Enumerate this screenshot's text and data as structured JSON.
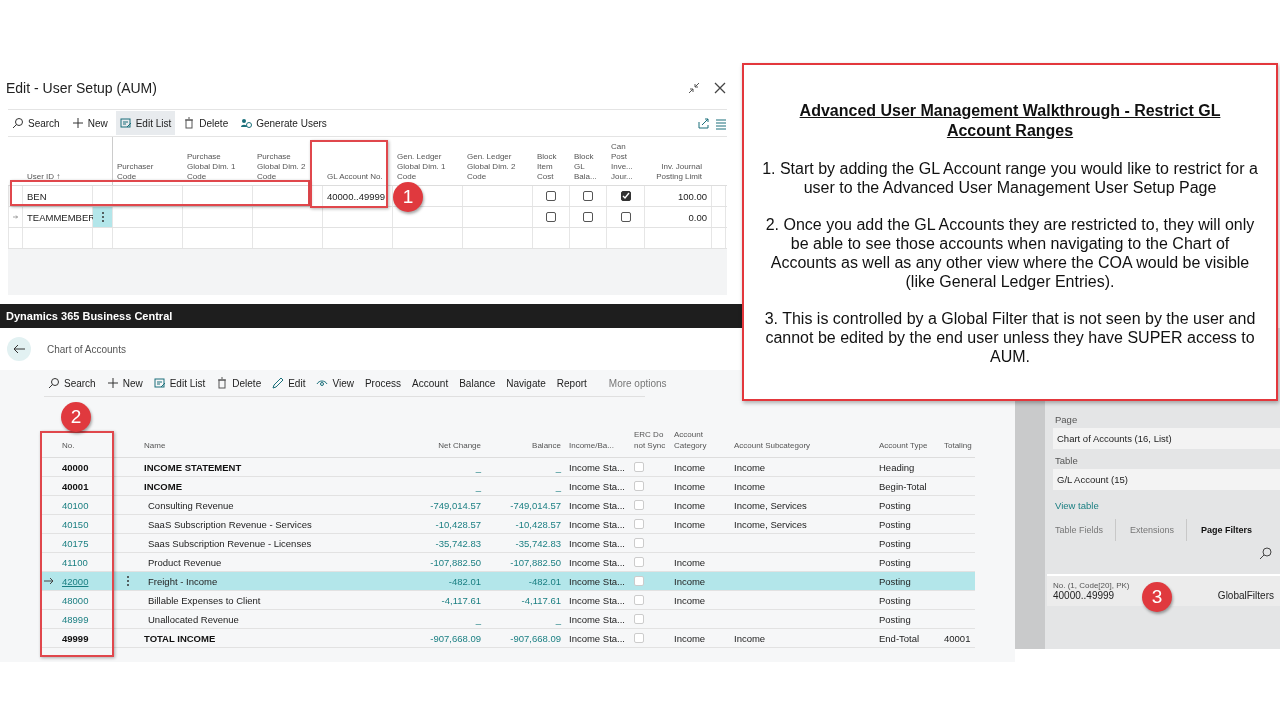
{
  "setup_window": {
    "title": "Edit - User Setup (AUM)",
    "toolbar": [
      {
        "label": "Search",
        "selected": false
      },
      {
        "label": "New",
        "selected": false
      },
      {
        "label": "Edit List",
        "selected": true
      },
      {
        "label": "Delete",
        "selected": false
      },
      {
        "label": "Generate Users",
        "selected": false
      }
    ],
    "columns": [
      "User ID ↑",
      "Purchaser Code",
      "Purchase Global Dim. 1 Code",
      "Purchase Global Dim. 2 Code",
      "GL Account No.",
      "Gen. Ledger Global Dim. 1 Code",
      "Gen. Ledger Global Dim. 2 Code",
      "Block Item Cost",
      "Block GL Bala...",
      "Can Post Inve... Jour...",
      "Inv. Journal Posting Limit"
    ],
    "rows": [
      {
        "user_id": "BEN",
        "gl_account_no": "40000..49999",
        "block_item_cost": false,
        "block_gl_balance": false,
        "can_post": true,
        "posting_limit": "100.00",
        "selected": false
      },
      {
        "user_id": "TEAMMEMBER",
        "block_item_cost": false,
        "block_gl_balance": false,
        "can_post": false,
        "posting_limit": "0.00",
        "selected": true
      }
    ]
  },
  "app_bar": {
    "title": "Dynamics 365 Business Central"
  },
  "chart_of_accounts": {
    "title": "Chart of Accounts",
    "toolbar": [
      "Search",
      "New",
      "Edit List",
      "Delete",
      "Edit",
      "View",
      "Process",
      "Account",
      "Balance",
      "Navigate",
      "Report"
    ],
    "more_options": "More options",
    "columns": [
      "No.",
      "Name",
      "Net Change",
      "Balance",
      "Income/Ba...",
      "ERC Do not Sync",
      "Account Category",
      "Account Subcategory",
      "Account Type",
      "Totaling"
    ],
    "rows": [
      {
        "kind": "heading",
        "no": "40000",
        "name": "INCOME STATEMENT",
        "net_change": "_",
        "balance": "_",
        "income_balance": "Income Sta...",
        "erc_do_not_sync": false,
        "category": "Income",
        "subcategory": "Income",
        "type": "Heading",
        "selected": false
      },
      {
        "kind": "heading",
        "no": "40001",
        "name": "INCOME",
        "net_change": "_",
        "balance": "_",
        "income_balance": "Income Sta...",
        "erc_do_not_sync": false,
        "category": "Income",
        "subcategory": "Income",
        "type": "Begin-Total",
        "selected": false
      },
      {
        "kind": "posting",
        "no": "40100",
        "name": "Consulting Revenue",
        "net_change": "-749,014.57",
        "balance": "-749,014.57",
        "income_balance": "Income Sta...",
        "erc_do_not_sync": false,
        "category": "Income",
        "subcategory": "Income, Services",
        "type": "Posting",
        "selected": false
      },
      {
        "kind": "posting",
        "no": "40150",
        "name": "SaaS Subscription Revenue - Services",
        "net_change": "-10,428.57",
        "balance": "-10,428.57",
        "income_balance": "Income Sta...",
        "erc_do_not_sync": false,
        "category": "Income",
        "subcategory": "Income, Services",
        "type": "Posting",
        "selected": false
      },
      {
        "kind": "posting",
        "no": "40175",
        "name": "Saas Subscription Revenue - Licenses",
        "net_change": "-35,742.83",
        "balance": "-35,742.83",
        "income_balance": "Income Sta...",
        "erc_do_not_sync": false,
        "type": "Posting",
        "selected": false
      },
      {
        "kind": "posting",
        "no": "41100",
        "name": "Product Revenue",
        "net_change": "-107,882.50",
        "balance": "-107,882.50",
        "income_balance": "Income Sta...",
        "erc_do_not_sync": false,
        "category": "Income",
        "type": "Posting",
        "selected": false
      },
      {
        "kind": "posting",
        "no": "42000",
        "name": "Freight - Income",
        "net_change": "-482.01",
        "balance": "-482.01",
        "income_balance": "Income Sta...",
        "erc_do_not_sync": false,
        "category": "Income",
        "type": "Posting",
        "selected": true
      },
      {
        "kind": "posting",
        "no": "48000",
        "name": "Billable Expenses to Client",
        "net_change": "-4,117.61",
        "balance": "-4,117.61",
        "income_balance": "Income Sta...",
        "erc_do_not_sync": false,
        "category": "Income",
        "type": "Posting",
        "selected": false
      },
      {
        "kind": "posting",
        "no": "48999",
        "name": "Unallocated Revenue",
        "net_change": "_",
        "balance": "_",
        "income_balance": "Income Sta...",
        "erc_do_not_sync": false,
        "type": "Posting",
        "selected": false
      },
      {
        "kind": "heading",
        "no": "49999",
        "name": "TOTAL INCOME",
        "net_change": "-907,668.09",
        "balance": "-907,668.09",
        "income_balance": "Income Sta...",
        "erc_do_not_sync": false,
        "category": "Income",
        "subcategory": "Income",
        "type": "End-Total",
        "totaling": "40001",
        "selected": false
      }
    ]
  },
  "page_inspector": {
    "page_label": "Page",
    "page_value": "Chart of Accounts (16, List)",
    "table_label": "Table",
    "table_value": "G/L Account (15)",
    "link": "View table",
    "tabs": [
      {
        "label": "Table Fields",
        "selected": false
      },
      {
        "label": "Extensions",
        "selected": false
      },
      {
        "label": "Page Filters",
        "selected": true
      }
    ],
    "filter": {
      "field": "No. (1, Code[20], PK)",
      "value": "40000..49999",
      "source": "GlobalFilters"
    }
  },
  "callout": {
    "title": "Advanced User Management Walkthrough - Restrict GL Account Ranges",
    "paragraphs": [
      "1. Start by adding the GL Account range you would like to restrict for a user to the Advanced User Management User Setup Page",
      "2. Once you add the GL Accounts they are restricted to, they will only be able to see those accounts when navigating to the Chart of Accounts as well as any other view where the COA would be visible (like General Ledger Entries).",
      "3. This is controlled by a Global Filter that is not seen by the user and cannot be edited by the end user unless they have SUPER access to AUM."
    ]
  },
  "step_badges": [
    "1",
    "2",
    "3"
  ]
}
